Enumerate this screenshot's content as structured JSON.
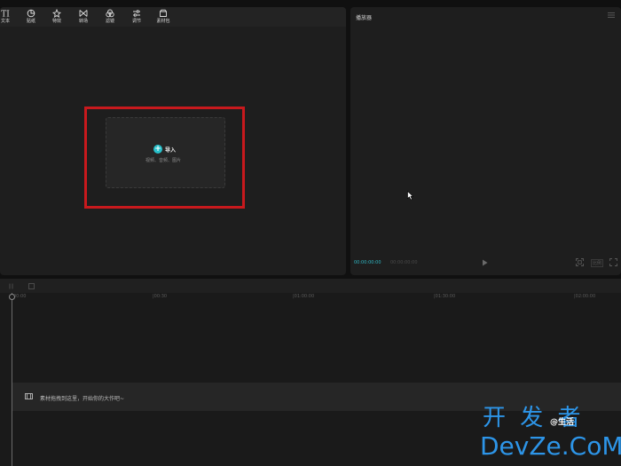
{
  "toolbar": {
    "items": [
      {
        "label": "文本",
        "icon": "text-icon"
      },
      {
        "label": "贴纸",
        "icon": "sticker-icon"
      },
      {
        "label": "特效",
        "icon": "effects-icon"
      },
      {
        "label": "转场",
        "icon": "transition-icon"
      },
      {
        "label": "滤镜",
        "icon": "filter-icon"
      },
      {
        "label": "调节",
        "icon": "adjust-icon"
      },
      {
        "label": "素材包",
        "icon": "package-icon"
      }
    ]
  },
  "import": {
    "button_label": "导入",
    "hint": "视频、音频、图片"
  },
  "player": {
    "title": "播放器",
    "current_time": "00:00:00:00",
    "total_time": "00:00:00:00",
    "ratio_label": "比例"
  },
  "timeline": {
    "ruler_labels": [
      "00:00",
      "|00:30",
      "|01:00:00",
      "|01:30:00",
      "|02:00:00"
    ],
    "track_hint": "素材拖拽到这里，开始你的大作吧~"
  },
  "watermark": {
    "line1": "开 发 者",
    "small": "@生活",
    "line2": "DevZe.CoM"
  },
  "colors": {
    "accent": "#27c0ca",
    "highlight": "#c8191d",
    "watermark": "#2d95e8"
  }
}
